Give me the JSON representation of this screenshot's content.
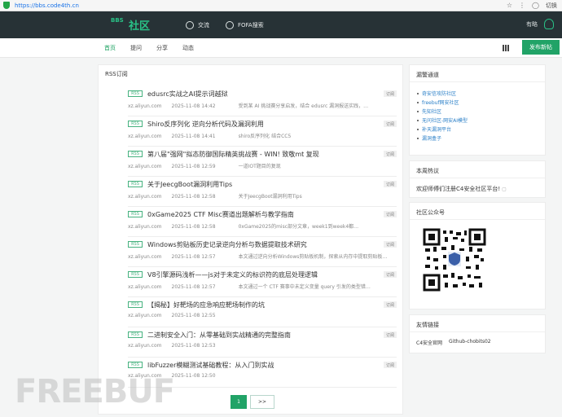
{
  "browser": {
    "url": "https://bbs.code4th.cn",
    "right_text": "切换"
  },
  "header": {
    "logo_bbs": "BBS",
    "logo_text": "社区",
    "nav": [
      {
        "label": "交流",
        "icon": "chat-icon"
      },
      {
        "label": "FOFA搜索",
        "icon": "search-icon"
      }
    ],
    "right_label": "有略",
    "right_icon": "bulb-icon"
  },
  "sub_nav": {
    "items": [
      "首页",
      "提问",
      "分享",
      "动态"
    ],
    "post_button": "发布新帖"
  },
  "main": {
    "title": "RSS订阅",
    "items": [
      {
        "badge": "RSS",
        "title": "edusrc实战之AI提示词越狱",
        "source": "xz.aliyun.com",
        "date": "2025-11-08 14:42",
        "desc": "受到某 AI 挑战赛分享启发，结合 edusrc 漏洞报送实践，…",
        "tag": "订阅"
      },
      {
        "badge": "RSS",
        "title": "Shiro反序列化 逆向分析代码及漏洞利用",
        "source": "xz.aliyun.com",
        "date": "2025-11-08 14:41",
        "desc": "shiro反序列化 结合CC5",
        "tag": "订阅"
      },
      {
        "badge": "RSS",
        "title": "第八届\"强网\"拟态防御国际精英挑战赛 - WIN! 致敬mt 复现",
        "source": "xz.aliyun.com",
        "date": "2025-11-08 12:59",
        "desc": "一道IOT题目的复现",
        "tag": "订阅"
      },
      {
        "badge": "RSS",
        "title": "关于JeecgBoot漏洞利用Tips",
        "source": "xz.aliyun.com",
        "date": "2025-11-08 12:58",
        "desc": "关于JeecgBoot漏洞利用Tips",
        "tag": "订阅"
      },
      {
        "badge": "RSS",
        "title": "0xGame2025 CTF Misc赛道出题解析与教学指南",
        "source": "xz.aliyun.com",
        "date": "2025-11-08 12:58",
        "desc": "0xGame2025的misc部分文章，week1到week4都…",
        "tag": "订阅"
      },
      {
        "badge": "RSS",
        "title": "Windows剪贴板历史记录逆向分析与数据提取技术研究",
        "source": "xz.aliyun.com",
        "date": "2025-11-08 12:57",
        "desc": "本文通过逆向分析Windows剪贴板机制，探索从内存中提取剪贴板…",
        "tag": "订阅"
      },
      {
        "badge": "RSS",
        "title": "V8引擎源码浅析——js对于未定义的标识符的底层处理逻辑",
        "source": "xz.aliyun.com",
        "date": "2025-11-08 12:57",
        "desc": "本文通过一个 CTF 赛事中未定义变量 query 引发的类型错…",
        "tag": "订阅"
      },
      {
        "badge": "RSS",
        "title": "【揭秘】好靶场的应急响应靶场制作的坑",
        "source": "xz.aliyun.com",
        "date": "2025-11-08 12:55",
        "desc": "",
        "tag": "订阅"
      },
      {
        "badge": "RSS",
        "title": "二进制安全入门：从零基础到实战精通的完整指南",
        "source": "xz.aliyun.com",
        "date": "2025-11-08 12:53",
        "desc": "",
        "tag": "订阅"
      },
      {
        "badge": "RSS",
        "title": "libFuzzer模糊测试基础教程：从入门到实战",
        "source": "xz.aliyun.com",
        "date": "2025-11-08 12:50",
        "desc": "",
        "tag": "订阅"
      }
    ],
    "pagination": {
      "current": "1",
      "next": ">>"
    }
  },
  "watermark": "FREEBUF",
  "sidebar": {
    "subscribe": {
      "title": "漏警通道",
      "links": [
        "奇安信攻防社区",
        "freebuf网安社区",
        "先知社区",
        "无问社区-网安AI模型",
        "补天漏洞平台",
        "漏洞盒子"
      ]
    },
    "hot": {
      "title": "本周热议",
      "text": "欢迎师傅们注册C4安全社区平台!"
    },
    "wechat": {
      "title": "社区公众号"
    },
    "friends": {
      "title": "友情链接",
      "links": [
        "C4安全官网",
        "Github-chobits02"
      ]
    }
  }
}
